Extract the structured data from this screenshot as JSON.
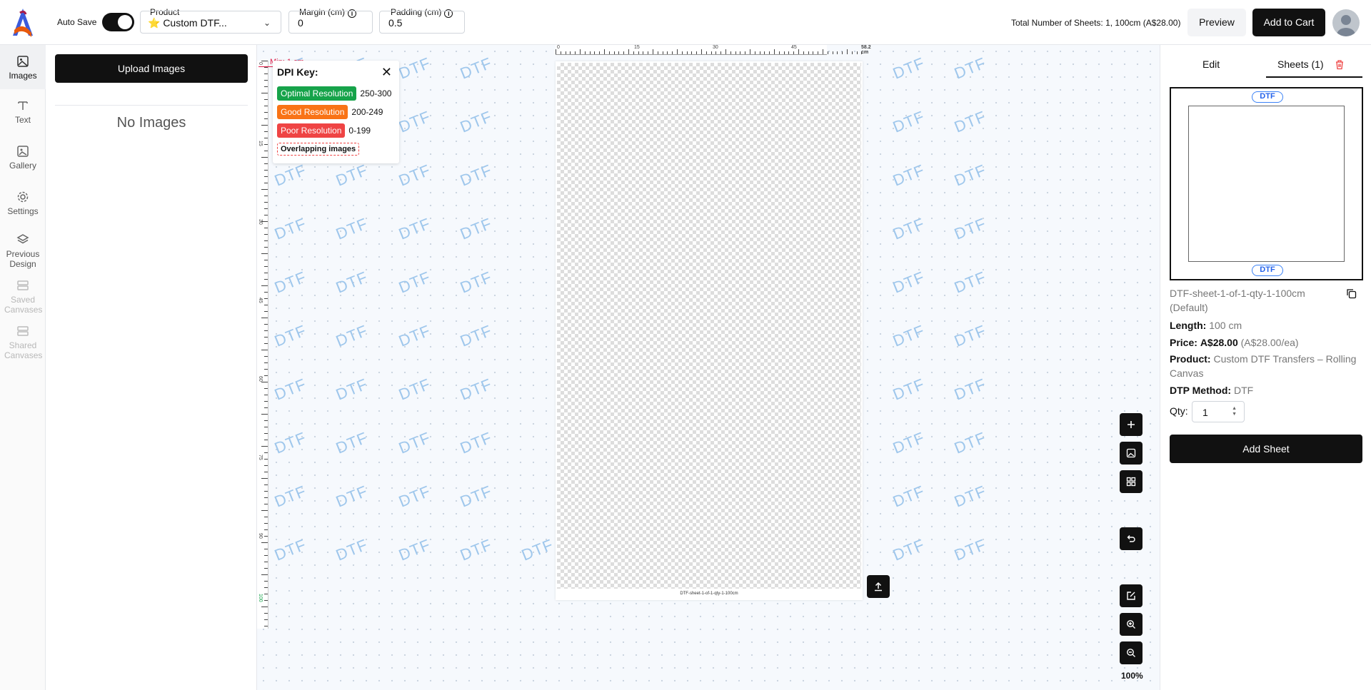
{
  "header": {
    "autosave_label": "Auto Save",
    "product_label": "Product",
    "product_value": "⭐ Custom DTF...",
    "margin_label": "Margin (cm)",
    "margin_value": "0",
    "padding_label": "Padding (cm)",
    "padding_value": "0.5",
    "total_text": "Total Number of Sheets: 1, 100cm (A$28.00)",
    "preview_label": "Preview",
    "cart_label": "Add to Cart"
  },
  "sidebar": {
    "items": [
      {
        "label": "Images",
        "icon": "image-icon"
      },
      {
        "label": "Text",
        "icon": "text-icon"
      },
      {
        "label": "Gallery",
        "icon": "gallery-icon"
      },
      {
        "label": "Settings",
        "icon": "gear-icon"
      },
      {
        "label": "Previous Design",
        "icon": "layers-icon"
      },
      {
        "label": "Saved Canvases",
        "icon": "grid-icon"
      },
      {
        "label": "Shared Canvases",
        "icon": "grid-icon"
      }
    ]
  },
  "images_panel": {
    "upload_label": "Upload Images",
    "empty_text": "No Images"
  },
  "canvas": {
    "watermark": "DTF",
    "min_label": "Min: 1 cm",
    "ruler_h_labels": [
      "0",
      "15",
      "30",
      "45",
      "58.2 cm"
    ],
    "ruler_v_labels": [
      "0",
      "15",
      "30",
      "45",
      "60",
      "75",
      "90",
      "100 cm"
    ],
    "sheet_caption": "DTF-sheet-1-of-1-qty-1-100cm",
    "zoom": "100%"
  },
  "dpi_key": {
    "title": "DPI Key:",
    "rows": [
      {
        "label": "Optimal Resolution",
        "range": "250-300",
        "color": "#16a34a"
      },
      {
        "label": "Good Resolution",
        "range": "200-249",
        "color": "#f97316"
      },
      {
        "label": "Poor Resolution",
        "range": "0-199",
        "color": "#ef4444"
      }
    ],
    "overlap_label": "Overlapping images"
  },
  "right_panel": {
    "tab_edit": "Edit",
    "tab_sheets": "Sheets (1)",
    "pill": "DTF",
    "sheet_name": "DTF-sheet-1-of-1-qty-1-100cm (Default)",
    "length_label": "Length:",
    "length_value": "100 cm",
    "price_label": "Price:",
    "price_value": "A$28.00",
    "price_each": "(A$28.00/ea)",
    "product_label": "Product:",
    "product_value": "Custom DTF Transfers – Rolling Canvas",
    "method_label": "DTP Method:",
    "method_value": "DTF",
    "qty_label": "Qty:",
    "qty_value": "1",
    "add_sheet_label": "Add Sheet"
  },
  "colors": {
    "primary": "#111111",
    "accent_blue": "#3b82f6",
    "danger": "#ef4444"
  }
}
